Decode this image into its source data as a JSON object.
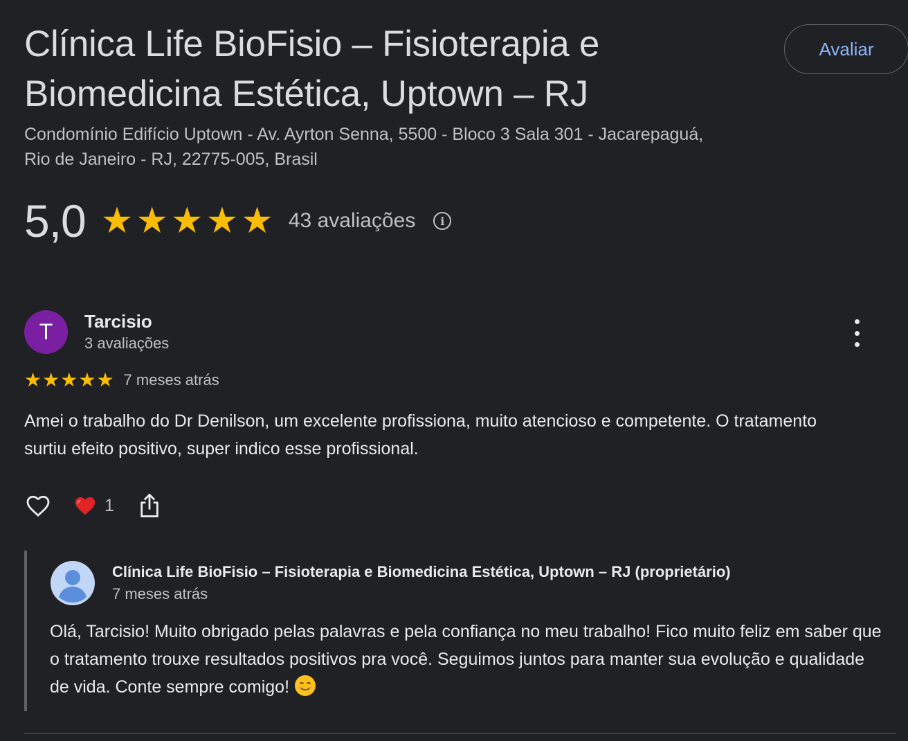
{
  "place": {
    "title": "Clínica Life BioFisio – Fisioterapia e Biomedicina Estética, Uptown – RJ",
    "address": "Condomínio Edifício Uptown - Av. Ayrton Senna, 5500 - Bloco 3 Sala 301 - Jacarepaguá, Rio de Janeiro - RJ, 22775-005, Brasil",
    "rate_button": "Avaliar"
  },
  "summary": {
    "score": "5,0",
    "stars": 5,
    "review_count": "43 avaliações",
    "info_icon": "info-icon"
  },
  "review": {
    "avatar_initial": "T",
    "avatar_color": "#7b1fa2",
    "name": "Tarcisio",
    "meta": "3 avaliações",
    "stars": 5,
    "date": "7 meses atrás",
    "text": "Amei o trabalho do Dr Denilson, um excelente profissiona, muito atencioso e competente. O tratamento surtiu efeito positivo, super indico esse profissional.",
    "reactions": {
      "like_icon": "heart-outline-icon",
      "love_icon": "red-heart-icon",
      "love_count": "1",
      "share_icon": "share-icon"
    }
  },
  "reply": {
    "name": "Clínica Life BioFisio – Fisioterapia e Biomedicina Estética, Uptown – RJ (proprietário)",
    "date": "7 meses atrás",
    "text": "Olá, Tarcisio! Muito obrigado pelas palavras e pela confiança no meu trabalho! Fico muito feliz em saber que o tratamento trouxe resultados positivos pra você. Seguimos juntos para manter sua evolução e qualidade de vida. Conte sempre comigo!",
    "emoji": "smiling-face-emoji"
  },
  "colors": {
    "background": "#202124",
    "star": "#fbbc04",
    "accent": "#8ab4f8",
    "heart": "#e02424"
  }
}
